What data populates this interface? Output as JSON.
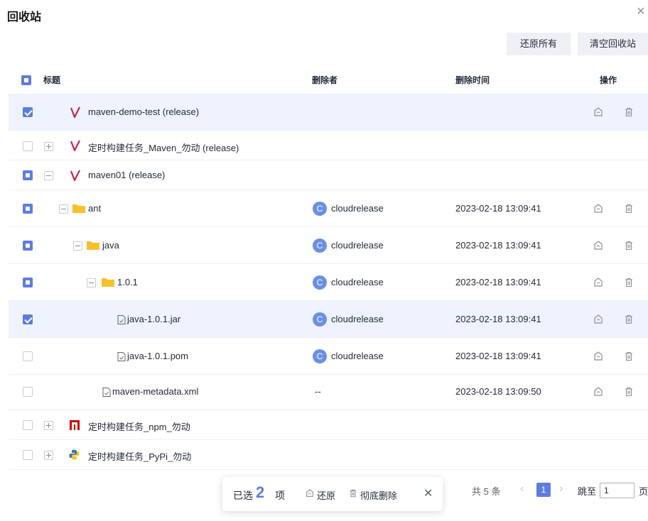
{
  "dialog": {
    "title": "回收站",
    "close_glyph": "×"
  },
  "toolbar": {
    "restore_all": "还原所有",
    "empty_bin": "清空回收站"
  },
  "table": {
    "columns": {
      "title": "标题",
      "deleter": "删除者",
      "deleted_time": "删除时间",
      "actions": "操作"
    },
    "rows": [
      {
        "name": "maven-demo-test (release)",
        "icon": "maven-icon",
        "checkbox": "checked",
        "selected": true
      },
      {
        "name": "定时构建任务_Maven_勿动 (release)",
        "icon": "maven-icon",
        "checkbox": "unchecked",
        "toggle": "expand"
      },
      {
        "name": "maven01 (release)",
        "icon": "maven-icon",
        "checkbox": "indeterminate",
        "toggle": "collapse"
      },
      {
        "name": "ant",
        "icon": "folder-icon",
        "checkbox": "indeterminate",
        "toggle": "collapse",
        "deleter": "cloudrelease",
        "avatar": "C",
        "time": "2023-02-18 13:09:41"
      },
      {
        "name": "java",
        "icon": "folder-icon",
        "checkbox": "indeterminate",
        "toggle": "collapse",
        "deleter": "cloudrelease",
        "avatar": "C",
        "time": "2023-02-18 13:09:41"
      },
      {
        "name": "1.0.1",
        "icon": "folder-icon",
        "checkbox": "indeterminate",
        "toggle": "collapse",
        "deleter": "cloudrelease",
        "avatar": "C",
        "time": "2023-02-18 13:09:41"
      },
      {
        "name": "java-1.0.1.jar",
        "icon": "file-icon",
        "checkbox": "checked",
        "selected": true,
        "deleter": "cloudrelease",
        "avatar": "C",
        "time": "2023-02-18 13:09:41"
      },
      {
        "name": "java-1.0.1.pom",
        "icon": "file-icon",
        "checkbox": "unchecked",
        "deleter": "cloudrelease",
        "avatar": "C",
        "time": "2023-02-18 13:09:41"
      },
      {
        "name": "maven-metadata.xml",
        "icon": "file-icon",
        "checkbox": "unchecked",
        "deleter": "--",
        "time": "2023-02-18 13:09:50"
      },
      {
        "name": "定时构建任务_npm_勿动",
        "icon": "npm-icon",
        "checkbox": "unchecked",
        "toggle": "expand"
      },
      {
        "name": "定时构建任务_PyPi_勿动",
        "icon": "python-icon",
        "checkbox": "unchecked",
        "toggle": "expand"
      }
    ]
  },
  "selection_bar": {
    "prefix": "已选",
    "count": "2",
    "suffix": "项",
    "restore": "还原",
    "delete": "彻底删除",
    "close_glyph": "✕"
  },
  "pagination": {
    "total_text": "共 5 条",
    "prev_glyph": "‹",
    "current_page": "1",
    "next_glyph": "›",
    "goto_label": "跳至",
    "goto_value": "1",
    "page_unit": "页"
  },
  "colors": {
    "accent": "#5e7ce0",
    "selected_row": "#eef3fe",
    "avatar": "#6b8fe6",
    "button_bg": "#eef0f5"
  }
}
